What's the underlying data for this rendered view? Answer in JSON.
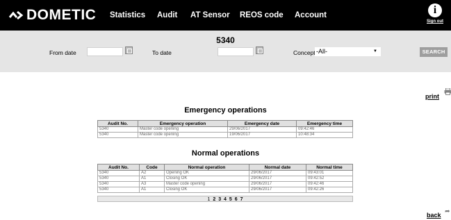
{
  "brand": {
    "name": "DOMETIC"
  },
  "nav": {
    "items": [
      {
        "label": "Statistics"
      },
      {
        "label": "Audit"
      },
      {
        "label": "AT Sensor"
      },
      {
        "label": "REOS code"
      },
      {
        "label": "Account"
      }
    ],
    "signout_label": "Sign out"
  },
  "filters": {
    "page_number": "5340",
    "from_label": "From date",
    "from_value": "",
    "to_label": "To date",
    "to_value": "",
    "concept_label": "Concept",
    "concept_value": "-All-",
    "search_label": "SEARCH"
  },
  "links": {
    "print": "print",
    "back": "back"
  },
  "emergency": {
    "title": "Emergency operations",
    "headers": [
      "Audit No.",
      "Emergency operation",
      "Emergency date",
      "Emergency time"
    ],
    "rows": [
      [
        "5340",
        "Master code opening",
        "29/06/2017",
        "09:42:46"
      ],
      [
        "5340",
        "Master code opening",
        "19/06/2017",
        "10:48:34"
      ]
    ]
  },
  "normal": {
    "title": "Normal operations",
    "headers": [
      "Audit No.",
      "Code",
      "Normal operation",
      "Normal date",
      "Normal time"
    ],
    "rows": [
      [
        "5340",
        "A2",
        "Opening OK",
        "29/06/2017",
        "09:43:01"
      ],
      [
        "5340",
        "A1",
        "Closing OK",
        "29/06/2017",
        "09:42:52"
      ],
      [
        "5340",
        "A3",
        "Master code opening",
        "29/06/2017",
        "09:42:46"
      ],
      [
        "5340",
        "A1",
        "Closing OK",
        "29/06/2017",
        "09:42:26"
      ]
    ],
    "pages": [
      "1",
      "2",
      "3",
      "4",
      "5",
      "6",
      "7"
    ]
  },
  "colors": {
    "topbar": "#000000",
    "filterbar": "#e5e5e5",
    "search_button": "#9e9e9e"
  }
}
